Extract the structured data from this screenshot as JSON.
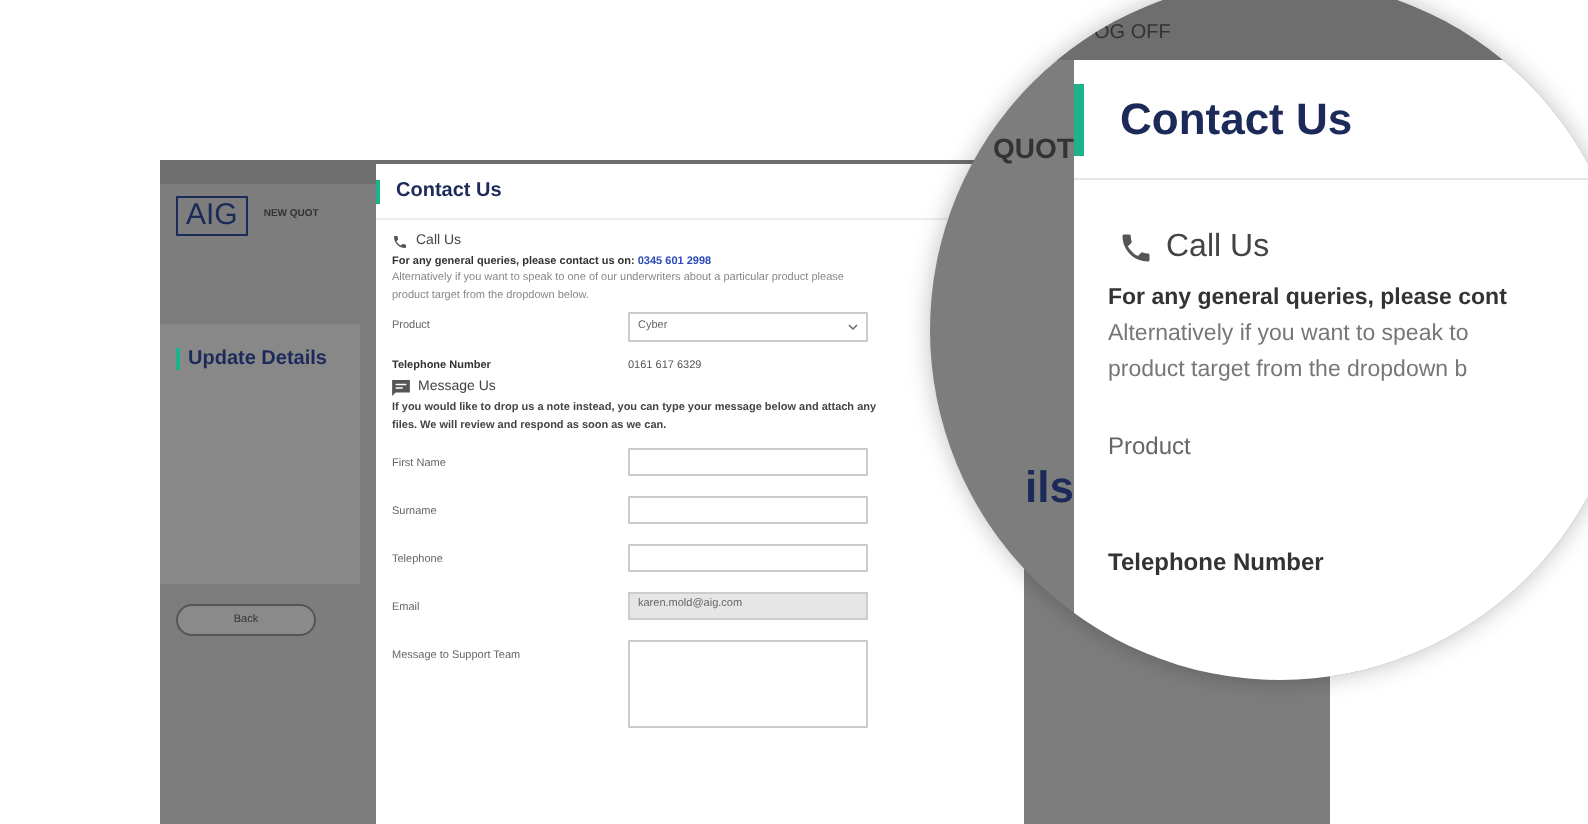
{
  "background_page": {
    "logo": "AIG",
    "nav_label": "NEW QUOT",
    "card_title": "Update Details",
    "back_button": "Back"
  },
  "modal": {
    "title": "Contact Us",
    "call_section": {
      "heading": "Call Us",
      "general_text": "For any general queries, please contact us on:",
      "phone_link": "0345 601 2998",
      "alt_lines": [
        "Alternatively if you want to speak to one of our underwriters about a particular product please",
        "product target from the dropdown below."
      ]
    },
    "product": {
      "label": "Product",
      "value": "Cyber"
    },
    "telephone": {
      "label": "Telephone Number",
      "value": "0161 617 6329"
    },
    "message_section": {
      "heading": "Message Us",
      "lines": [
        "If you would like to drop us a note instead, you can type your message below and attach any",
        "files. We will review and respond as soon as we can."
      ]
    },
    "fields": [
      {
        "label": "First Name",
        "kind": "input",
        "disabled": false
      },
      {
        "label": "Surname",
        "kind": "input",
        "disabled": false
      },
      {
        "label": "Telephone",
        "kind": "input",
        "disabled": false
      },
      {
        "label": "Email",
        "kind": "input",
        "value": "karen.mold@aig.com",
        "disabled": true
      },
      {
        "label": "Message to Support Team",
        "kind": "textarea",
        "disabled": false
      }
    ]
  },
  "magnifier": {
    "top_link": "OG OFF",
    "nav_label": "QUOT",
    "side_title": "ils",
    "title": "Contact Us",
    "call_heading": "Call Us",
    "lines": [
      "For any general queries, please cont",
      "Alternatively if you want to speak to",
      "product target from the dropdown b"
    ],
    "product_label": "Product",
    "telephone_label": "Telephone Number"
  }
}
